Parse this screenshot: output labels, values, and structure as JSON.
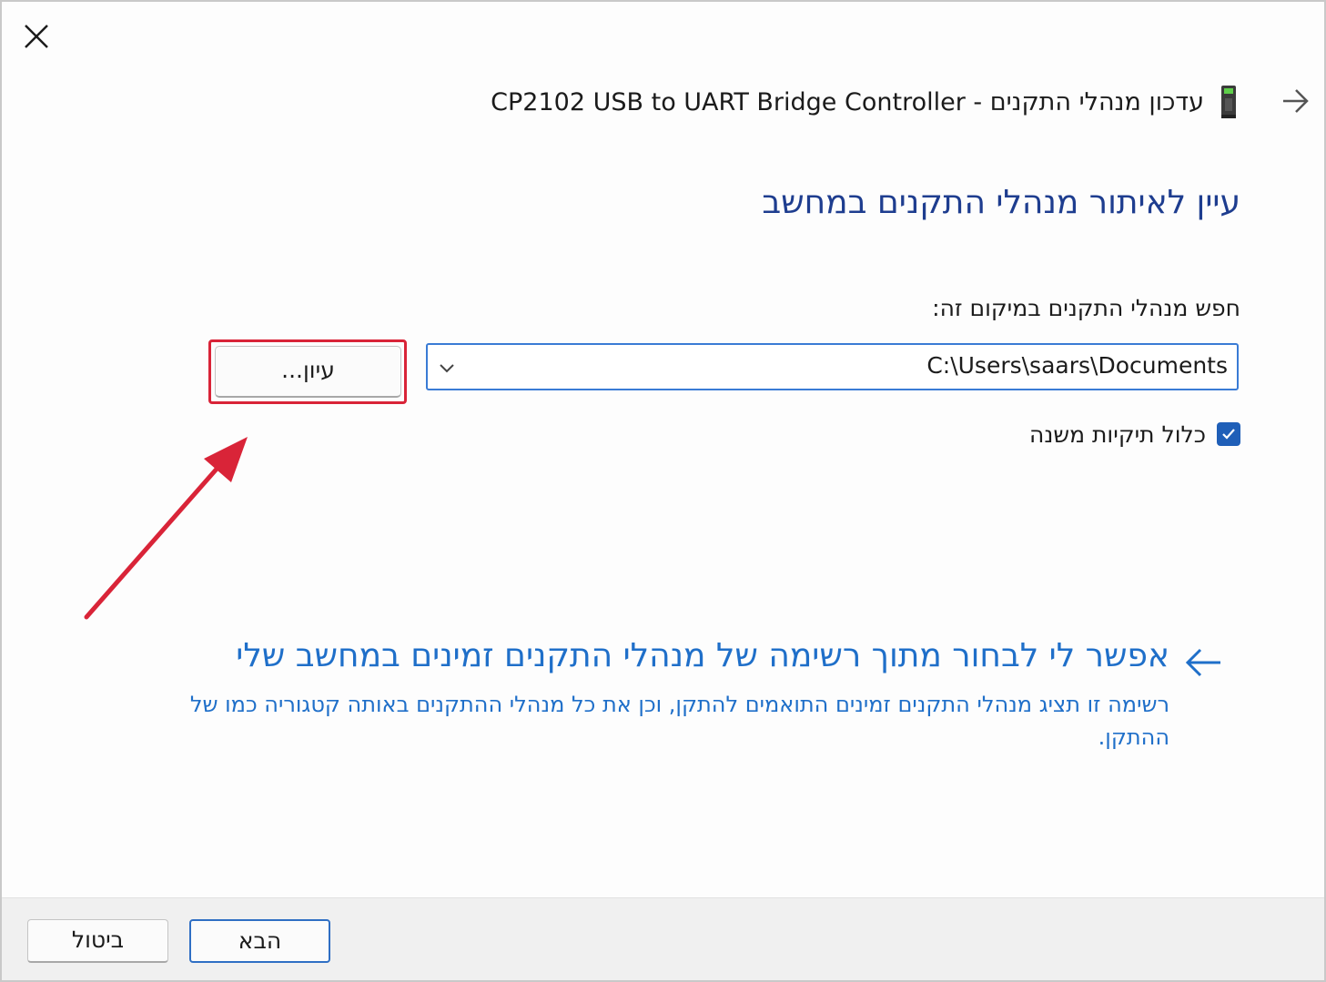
{
  "window": {
    "title": "CP2102 USB to UART Bridge Controller - עדכון מנהלי התקנים"
  },
  "main": {
    "heading": "עיין לאיתור מנהלי התקנים במחשב",
    "search_label": "חפש מנהלי התקנים במיקום זה:",
    "path_value": "C:\\Users\\saars\\Documents",
    "browse_label": "עיון...",
    "include_subfolders_label": "כלול תיקיות משנה",
    "include_subfolders_checked": true
  },
  "option": {
    "title": "אפשר לי לבחור מתוך רשימה של מנהלי התקנים זמינים במחשב שלי",
    "description": "רשימה זו תציג מנהלי התקנים זמינים התואמים להתקן, וכן את כל מנהלי ההתקנים באותה קטגוריה כמו של ההתקן."
  },
  "footer": {
    "next_label": "הבא",
    "cancel_label": "ביטול"
  },
  "colors": {
    "heading": "#1e3d8f",
    "link": "#1f6fc9",
    "accent": "#1f5fb8",
    "annotation": "#d92438"
  },
  "icons": {
    "close": "close-icon",
    "back": "back-arrow-icon",
    "device": "usb-device-icon",
    "chevron": "chevron-down-icon",
    "check": "checkmark-icon",
    "link_arrow": "arrow-left-icon"
  }
}
